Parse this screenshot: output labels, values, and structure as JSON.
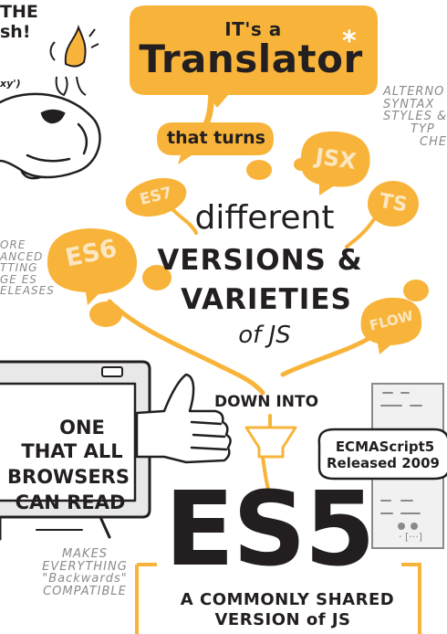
{
  "colors": {
    "accent": "#f8b43a",
    "accent_text": "#fbe7c2",
    "ink": "#231f20",
    "note": "#8a8a8a"
  },
  "top_left_text": [
    "THE",
    "sh!"
  ],
  "mascot_note": "xy')",
  "title": {
    "small": "IT's a",
    "big": "Translator",
    "asterisk": "*",
    "turns": "that turns"
  },
  "alt_note": [
    "ALTERNO",
    "SYNTAX",
    "STYLES &",
    "TYP",
    "CHE"
  ],
  "left_note": [
    "ORE",
    "ANCED",
    "TTING",
    "GE ES",
    "ELEASES"
  ],
  "bubbles": {
    "es7": "ES7",
    "jsx": "JSX",
    "ts": "TS",
    "es6": "ES6",
    "flow": "FLOW"
  },
  "center_text": [
    "different",
    "VERSIONS &",
    "VARIETIES",
    "of JS"
  ],
  "down_into": "DOWN INTO",
  "screen_text": [
    "ONE",
    "THAT ALL",
    "BROWSERS",
    "CAN READ"
  ],
  "makes_note": [
    "MAKES",
    "EVERYTHING",
    "\"Backwards\"",
    "COMPATIBLE"
  ],
  "ecma": [
    "ECMAScript5",
    "Released 2009"
  ],
  "scroll_scribble": "· [···]",
  "result": {
    "big": "ES5",
    "line1": "A COMMONLY SHARED",
    "line2": "VERSION of JS"
  }
}
